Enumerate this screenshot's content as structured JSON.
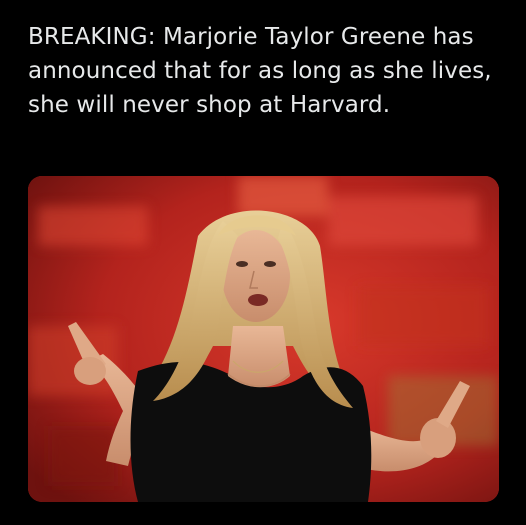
{
  "post": {
    "text": "BREAKING: Marjorie Taylor Greene has announced that for as long as she lives, she will never shop at Harvard."
  },
  "media": {
    "subject": "woman speaking on stage, pointing both index fingers upward",
    "background_color": "#b3231d",
    "dress_color": "#0d0d0d",
    "hair_color": "#d6b57a"
  }
}
